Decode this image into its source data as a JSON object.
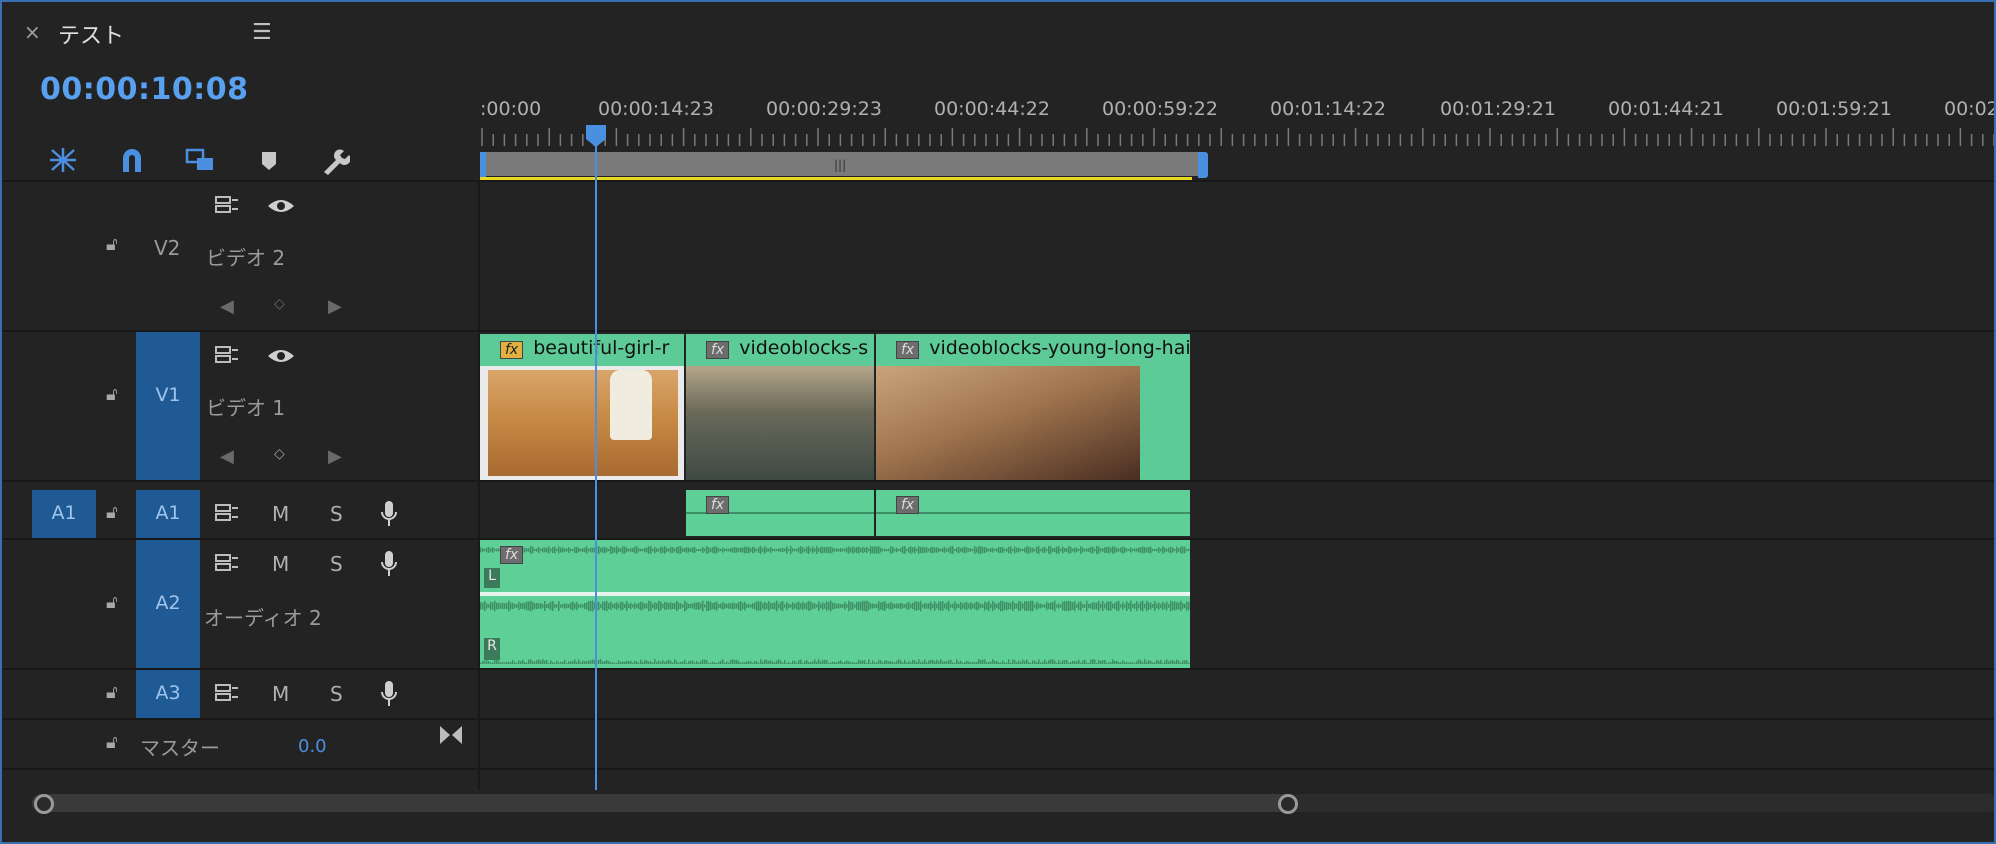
{
  "panel": {
    "close_icon": "×",
    "title": "テスト",
    "menu_icon": "☰"
  },
  "timecode": "00:00:10:08",
  "toolbar": {
    "icons": [
      "nest-sequence-icon",
      "snap-magnet-icon",
      "linked-selection-icon",
      "add-marker-icon",
      "settings-wrench-icon"
    ]
  },
  "ruler": {
    "labels": [
      ":00:00",
      "00:00:14:23",
      "00:00:29:23",
      "00:00:44:22",
      "00:00:59:22",
      "00:01:14:22",
      "00:01:29:21",
      "00:01:44:21",
      "00:01:59:21",
      "00:02:"
    ]
  },
  "tracks": {
    "v2": {
      "id": "V2",
      "name": "ビデオ 2"
    },
    "v1": {
      "id": "V1",
      "name": "ビデオ 1"
    },
    "a1": {
      "source": "A1",
      "id": "A1",
      "mute": "M",
      "solo": "S"
    },
    "a2": {
      "id": "A2",
      "name": "オーディオ 2",
      "mute": "M",
      "solo": "S",
      "left": "L",
      "right": "R"
    },
    "a3": {
      "id": "A3",
      "mute": "M",
      "solo": "S"
    },
    "master": {
      "name": "マスター",
      "value": "0.0"
    }
  },
  "clips": {
    "v1": [
      {
        "label": "beautiful-girl-r",
        "fx": "fx"
      },
      {
        "label": "videoblocks-s",
        "fx": "fx"
      },
      {
        "label": "videoblocks-young-long-hai",
        "fx": "fx"
      }
    ],
    "a1_fx": [
      "fx",
      "fx"
    ],
    "a2_fx": "fx"
  },
  "colors": {
    "accent": "#4a8fe0",
    "clip": "#5dcb97",
    "track_badge": "#1f5a94"
  }
}
